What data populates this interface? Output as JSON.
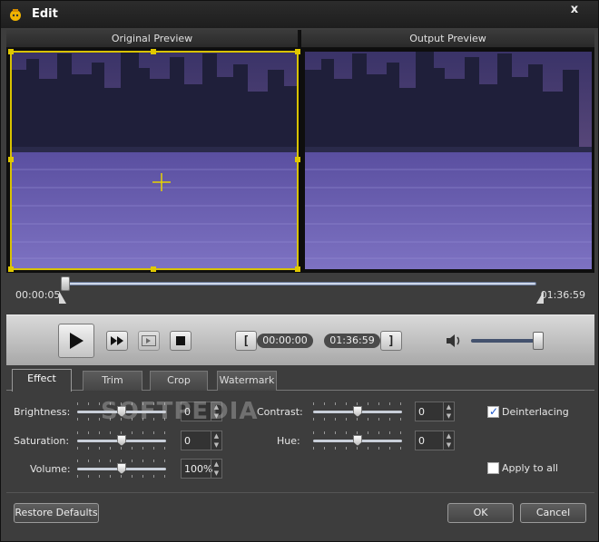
{
  "window": {
    "title": "Edit",
    "close_symbol": "x"
  },
  "preview": {
    "original_label": "Original Preview",
    "output_label": "Output Preview"
  },
  "timeline": {
    "start_time": "00:00:05",
    "end_time": "01:36:59"
  },
  "controls": {
    "trim_start": "00:00:00",
    "trim_end": "01:36:59",
    "bracket_left": "[",
    "bracket_right": "]",
    "volume_level": 0.95
  },
  "tabs": [
    {
      "label": "Effect",
      "active": true
    },
    {
      "label": "Trim",
      "active": false
    },
    {
      "label": "Crop",
      "active": false
    },
    {
      "label": "Watermark",
      "active": false
    }
  ],
  "effect": {
    "brightness": {
      "label": "Brightness:",
      "value": "0"
    },
    "contrast": {
      "label": "Contrast:",
      "value": "0"
    },
    "saturation": {
      "label": "Saturation:",
      "value": "0"
    },
    "hue": {
      "label": "Hue:",
      "value": "0"
    },
    "volume": {
      "label": "Volume:",
      "value": "100%"
    },
    "deinterlacing": {
      "label": "Deinterlacing",
      "checked": true
    },
    "apply_to_all": {
      "label": "Apply to all",
      "checked": false
    }
  },
  "buttons": {
    "restore_defaults": "Restore Defaults",
    "ok": "OK",
    "cancel": "Cancel"
  },
  "watermark_overlay": "SOFTPEDIA",
  "colors": {
    "crop_border": "#d8c200",
    "window_bg": "#3d3d3d",
    "accent": "#1a55c9"
  }
}
